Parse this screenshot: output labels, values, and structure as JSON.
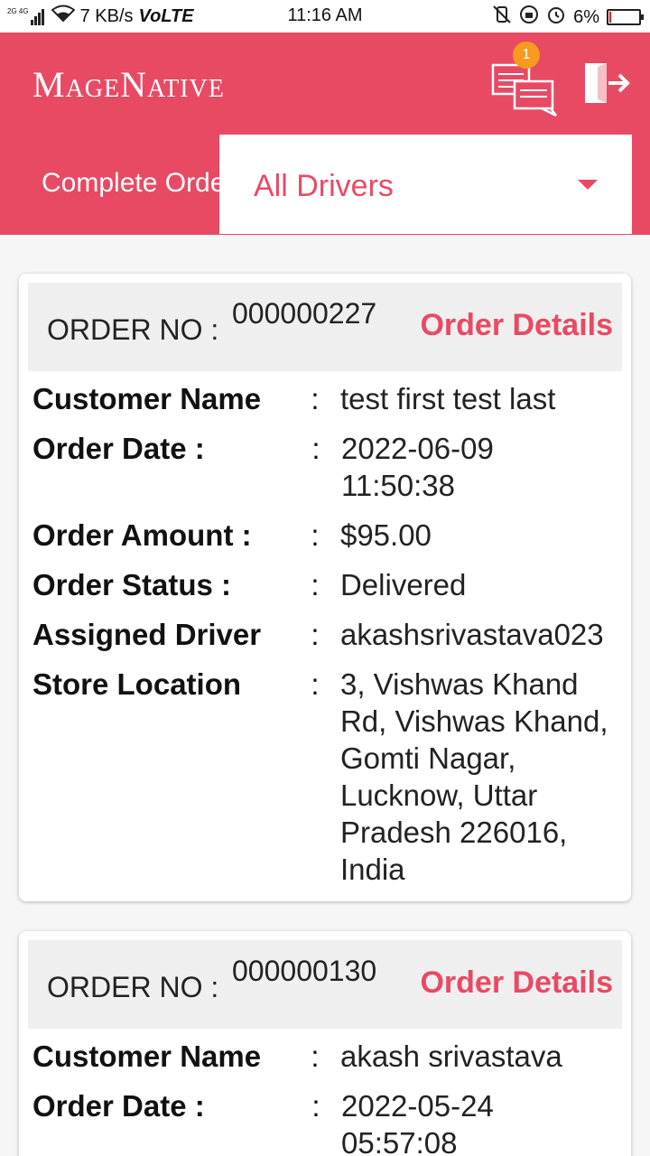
{
  "status_bar": {
    "net_label": "2G 4G",
    "speed": "7 KB/s",
    "volte": "VoLTE",
    "time": "11:16 AM",
    "battery": "6%",
    "battery_level": 0.06
  },
  "header": {
    "brand": "MageNative",
    "chat_badge": "1",
    "tab_label": "Complete Orders",
    "driver_filter": "All Drivers"
  },
  "colors": {
    "accent": "#e84a64",
    "badge": "#f79a1e"
  },
  "orders": [
    {
      "order_no_label": "ORDER NO :",
      "order_no": "000000227",
      "details_link": "Order Details",
      "fields": [
        {
          "label": "Customer Name",
          "colon": ":",
          "value": "test first test last"
        },
        {
          "label": "Order Date :",
          "colon": ":",
          "value": "2022-06-09 11:50:38"
        },
        {
          "label": "Order Amount :",
          "colon": ":",
          "value": "$95.00"
        },
        {
          "label": "Order Status :",
          "colon": ":",
          "value": "Delivered"
        },
        {
          "label": "Assigned Driver",
          "colon": ":",
          "value": "akashsrivastava023"
        },
        {
          "label": "Store Location",
          "colon": ":",
          "value": "3, Vishwas Khand Rd, Vishwas Khand, Gomti Nagar, Lucknow, Uttar Pradesh 226016, India"
        }
      ]
    },
    {
      "order_no_label": "ORDER NO :",
      "order_no": "000000130",
      "details_link": "Order Details",
      "fields": [
        {
          "label": "Customer Name",
          "colon": ":",
          "value": "akash srivastava"
        },
        {
          "label": "Order Date :",
          "colon": ":",
          "value": "2022-05-24 05:57:08"
        }
      ]
    }
  ]
}
